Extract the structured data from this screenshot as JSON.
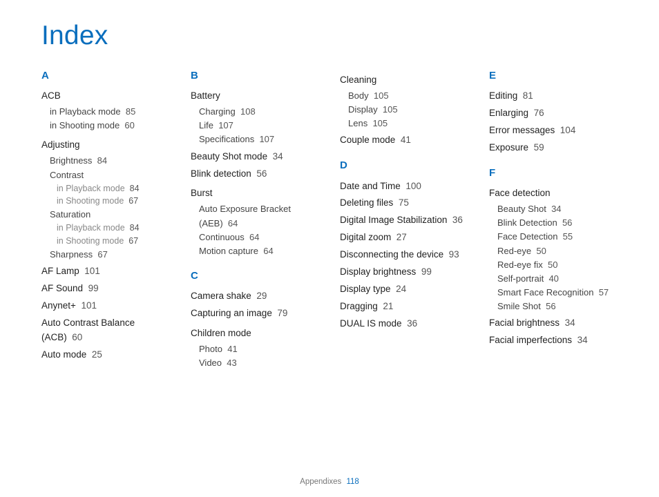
{
  "title": "Index",
  "footer": {
    "section": "Appendixes",
    "page": "118"
  },
  "columns": [
    {
      "sections": [
        {
          "letter": "A",
          "items": [
            {
              "head": "ACB",
              "subs": [
                {
                  "text": "in Playback mode",
                  "page": "85"
                },
                {
                  "text": "in Shooting mode",
                  "page": "60"
                }
              ]
            },
            {
              "head": "Adjusting",
              "subs": [
                {
                  "text": "Brightness",
                  "page": "84"
                },
                {
                  "text": "Contrast",
                  "subs2": [
                    {
                      "text": "in Playback mode",
                      "page": "84"
                    },
                    {
                      "text": "in Shooting mode",
                      "page": "67"
                    }
                  ]
                },
                {
                  "text": "Saturation",
                  "subs2": [
                    {
                      "text": "in Playback mode",
                      "page": "84"
                    },
                    {
                      "text": "in Shooting mode",
                      "page": "67"
                    }
                  ]
                },
                {
                  "text": "Sharpness",
                  "page": "67"
                }
              ]
            },
            {
              "line": "AF Lamp",
              "page": "101"
            },
            {
              "line": "AF Sound",
              "page": "99"
            },
            {
              "line": "Anynet+",
              "page": "101"
            },
            {
              "line": "Auto Contrast Balance (ACB)",
              "page": "60"
            },
            {
              "line": "Auto mode",
              "page": "25"
            }
          ]
        }
      ]
    },
    {
      "sections": [
        {
          "letter": "B",
          "items": [
            {
              "head": "Battery",
              "subs": [
                {
                  "text": "Charging",
                  "page": "108"
                },
                {
                  "text": "Life",
                  "page": "107"
                },
                {
                  "text": "Specifications",
                  "page": "107"
                }
              ]
            },
            {
              "line": "Beauty Shot mode",
              "page": "34"
            },
            {
              "line": "Blink detection",
              "page": "56"
            },
            {
              "head": "Burst",
              "subs": [
                {
                  "text": "Auto Exposure Bracket (AEB)",
                  "page": "64"
                },
                {
                  "text": "Continuous",
                  "page": "64"
                },
                {
                  "text": "Motion capture",
                  "page": "64"
                }
              ]
            }
          ]
        },
        {
          "letter": "C",
          "items": [
            {
              "line": "Camera shake",
              "page": "29"
            },
            {
              "line": "Capturing an image",
              "page": "79"
            },
            {
              "head": "Children mode",
              "subs": [
                {
                  "text": "Photo",
                  "page": "41"
                },
                {
                  "text": "Video",
                  "page": "43"
                }
              ]
            }
          ]
        }
      ]
    },
    {
      "sections": [
        {
          "items": [
            {
              "head": "Cleaning",
              "subs": [
                {
                  "text": "Body",
                  "page": "105"
                },
                {
                  "text": "Display",
                  "page": "105"
                },
                {
                  "text": "Lens",
                  "page": "105"
                }
              ]
            },
            {
              "line": "Couple mode",
              "page": "41"
            }
          ]
        },
        {
          "letter": "D",
          "items": [
            {
              "line": "Date and Time",
              "page": "100"
            },
            {
              "line": "Deleting files",
              "page": "75"
            },
            {
              "line": "Digital Image Stabilization",
              "page": "36"
            },
            {
              "line": "Digital zoom",
              "page": "27"
            },
            {
              "line": "Disconnecting the device",
              "page": "93"
            },
            {
              "line": "Display brightness",
              "page": "99"
            },
            {
              "line": "Display type",
              "page": "24"
            },
            {
              "line": "Dragging",
              "page": "21"
            },
            {
              "line": "DUAL IS mode",
              "page": "36"
            }
          ]
        }
      ]
    },
    {
      "sections": [
        {
          "letter": "E",
          "items": [
            {
              "line": "Editing",
              "page": "81"
            },
            {
              "line": "Enlarging",
              "page": "76"
            },
            {
              "line": "Error messages",
              "page": "104"
            },
            {
              "line": "Exposure",
              "page": "59"
            }
          ]
        },
        {
          "letter": "F",
          "items": [
            {
              "head": "Face detection",
              "subs": [
                {
                  "text": "Beauty Shot",
                  "page": "34"
                },
                {
                  "text": "Blink Detection",
                  "page": "56"
                },
                {
                  "text": "Face Detection",
                  "page": "55"
                },
                {
                  "text": "Red-eye",
                  "page": "50"
                },
                {
                  "text": "Red-eye fix",
                  "page": "50"
                },
                {
                  "text": "Self-portrait",
                  "page": "40"
                },
                {
                  "text": "Smart Face Recognition",
                  "page": "57"
                },
                {
                  "text": "Smile Shot",
                  "page": "56"
                }
              ]
            },
            {
              "line": "Facial brightness",
              "page": "34"
            },
            {
              "line": "Facial imperfections",
              "page": "34"
            }
          ]
        }
      ]
    }
  ]
}
